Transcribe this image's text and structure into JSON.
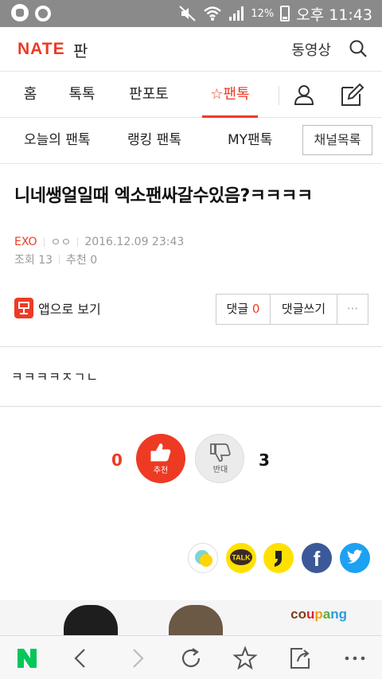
{
  "status_bar": {
    "battery_percent": "12%",
    "time": "오후 11:43"
  },
  "header": {
    "logo": "NATE",
    "logo_sub": "판",
    "video_label": "동영상"
  },
  "tabs": [
    {
      "label": "홈"
    },
    {
      "label": "톡톡"
    },
    {
      "label": "판포토"
    },
    {
      "label": "☆팬톡",
      "active": true
    }
  ],
  "subtabs": [
    {
      "label": "오늘의 팬톡"
    },
    {
      "label": "랭킹 팬톡"
    },
    {
      "label": "MY팬톡"
    }
  ],
  "channel_list_button": "채널목록",
  "article": {
    "title": "니네쌩얼일때 엑소팬싸갈수있음?ㅋㅋㅋㅋ",
    "channel": "EXO",
    "author": "ㅇㅇ",
    "date": "2016.12.09 23:43",
    "views_label": "조회 13",
    "recommend_label": "추천 0",
    "content": "ㅋㅋㅋㅋㅈㄱㄴ"
  },
  "app_view_label": "앱으로 보기",
  "comments": {
    "label": "댓글",
    "count": "0",
    "write_label": "댓글쓰기",
    "more_label": "···"
  },
  "votes": {
    "up_count": "0",
    "up_label": "추천",
    "down_count": "3",
    "down_label": "반대"
  },
  "share_buttons": [
    "kakaostory-icon",
    "kakaotalk-icon",
    "kakao-quote-icon",
    "facebook-icon",
    "twitter-icon"
  ],
  "share": {
    "talk_label": "TALK",
    "facebook_label": "f"
  },
  "ad": {
    "brand": "coupang"
  },
  "bottom_nav": [
    "naver-home-icon",
    "back-icon",
    "forward-icon",
    "refresh-icon",
    "bookmark-star-icon",
    "share-icon",
    "more-icon"
  ],
  "colors": {
    "accent": "#ee3a23",
    "status_bar": "#8a8a8a",
    "facebook": "#3b5998",
    "twitter": "#1da1f2",
    "kakao": "#ffe100",
    "naver": "#03c75a"
  }
}
